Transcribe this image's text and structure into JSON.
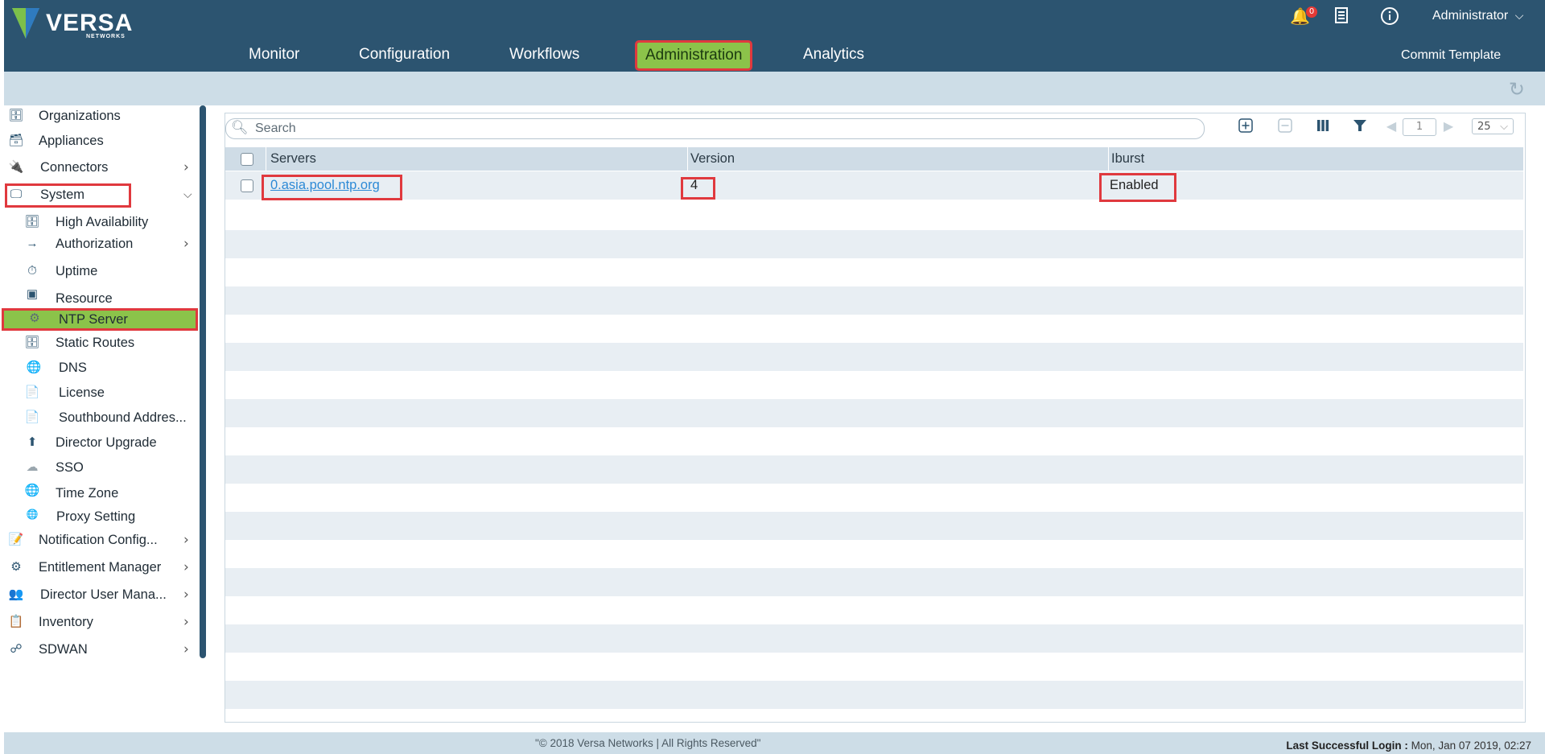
{
  "app": {
    "brand": "VERSA",
    "brand_sub": "NETWORKS"
  },
  "nav": {
    "items": [
      {
        "label": "Monitor"
      },
      {
        "label": "Configuration"
      },
      {
        "label": "Workflows"
      },
      {
        "label": "Administration",
        "active": true
      },
      {
        "label": "Analytics"
      }
    ],
    "commit_label": "Commit Template"
  },
  "header": {
    "notification_count": "0",
    "user_label": "Administrator",
    "icons": [
      "bell-icon",
      "clipboard-icon",
      "info-icon",
      "chevron-down-icon"
    ]
  },
  "sidebar": {
    "items": [
      {
        "label": "Organizations",
        "icon": "organizations-icon"
      },
      {
        "label": "Appliances",
        "icon": "appliances-icon"
      },
      {
        "label": "Connectors",
        "icon": "connectors-icon",
        "expandable": true
      },
      {
        "label": "System",
        "icon": "system-icon",
        "expanded": true
      },
      {
        "label": "High Availability",
        "icon": "high-availability-icon",
        "child": true
      },
      {
        "label": "Authorization",
        "icon": "authorization-icon",
        "child": true,
        "expandable": true
      },
      {
        "label": "Uptime",
        "icon": "uptime-icon",
        "child": true
      },
      {
        "label": "Resource",
        "icon": "resource-icon",
        "child": true
      },
      {
        "label": "NTP Server",
        "icon": "ntp-server-icon",
        "child": true,
        "selected": true
      },
      {
        "label": "Static Routes",
        "icon": "static-routes-icon",
        "child": true
      },
      {
        "label": "DNS",
        "icon": "dns-icon",
        "child": true
      },
      {
        "label": "License",
        "icon": "license-icon",
        "child": true
      },
      {
        "label": "Southbound Addres...",
        "icon": "southbound-address-icon",
        "child": true
      },
      {
        "label": "Director Upgrade",
        "icon": "director-upgrade-icon",
        "child": true
      },
      {
        "label": "SSO",
        "icon": "sso-icon",
        "child": true
      },
      {
        "label": "Time Zone",
        "icon": "time-zone-icon",
        "child": true
      },
      {
        "label": "Proxy Setting",
        "icon": "proxy-setting-icon",
        "child": true
      },
      {
        "label": "Notification Config...",
        "icon": "notification-config-icon",
        "expandable": true
      },
      {
        "label": "Entitlement Manager",
        "icon": "entitlement-manager-icon",
        "expandable": true
      },
      {
        "label": "Director User Mana...",
        "icon": "director-user-management-icon",
        "expandable": true
      },
      {
        "label": "Inventory",
        "icon": "inventory-icon",
        "expandable": true
      },
      {
        "label": "SDWAN",
        "icon": "sdwan-icon",
        "expandable": true
      }
    ]
  },
  "search": {
    "placeholder": "Search"
  },
  "toolbar": {
    "page": "1",
    "per_page": "25",
    "icons": [
      "add-icon",
      "remove-icon",
      "columns-icon",
      "filter-icon",
      "prev-page-icon",
      "next-page-icon"
    ]
  },
  "table": {
    "headers": [
      "Servers",
      "Version",
      "Iburst"
    ],
    "rows": [
      {
        "server": "0.asia.pool.ntp.org",
        "version": "4",
        "iburst": "Enabled"
      }
    ]
  },
  "footer": {
    "copyright": "\"© 2018 Versa Networks | All Rights Reserved\"",
    "last_login_label": "Last Successful Login :",
    "last_login_value": "Mon, Jan 07 2019, 02:27"
  }
}
